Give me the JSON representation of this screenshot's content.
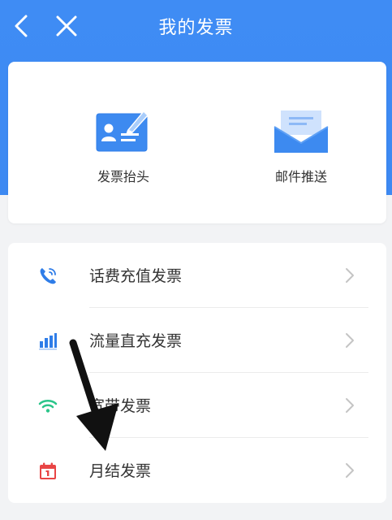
{
  "header": {
    "title": "我的发票"
  },
  "features": [
    {
      "label": "发票抬头",
      "icon": "invoice-title-card-icon"
    },
    {
      "label": "邮件推送",
      "icon": "email-envelope-icon"
    }
  ],
  "invoice_types": [
    {
      "label": "话费充值发票",
      "icon": "phone-icon"
    },
    {
      "label": "流量直充发票",
      "icon": "bar-signal-icon"
    },
    {
      "label": "宽带发票",
      "icon": "wifi-icon"
    },
    {
      "label": "月结发票",
      "icon": "calendar-icon"
    }
  ],
  "colors": {
    "header_blue": "#3f8cf4",
    "icon_blue": "#2f7de8",
    "wifi_green": "#2bc58a",
    "calendar_red": "#e84545"
  }
}
